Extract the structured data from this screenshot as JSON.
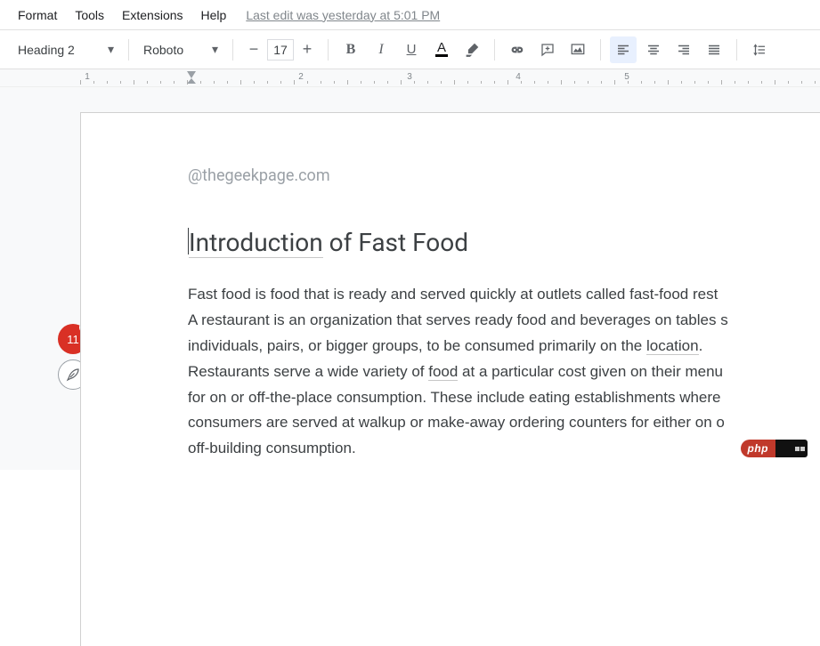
{
  "menubar": {
    "items": [
      "Format",
      "Tools",
      "Extensions",
      "Help"
    ],
    "last_edit": "Last edit was yesterday at 5:01 PM"
  },
  "toolbar": {
    "style_label": "Heading 2",
    "font_label": "Roboto",
    "font_size": "17",
    "minus": "−",
    "plus": "+",
    "bold": "B",
    "italic": "I",
    "underline": "U",
    "text_color": "A"
  },
  "ruler": {
    "numbers": [
      "1",
      "2",
      "3",
      "4",
      "5"
    ]
  },
  "sidebar": {
    "badge_count": "11",
    "badge_plus": "+"
  },
  "document": {
    "watermark": "@thegeekpage.com",
    "heading_word1": "Introduction",
    "heading_rest": " of Fast Food",
    "body_line1a": "Fast food is food that is ready and served quickly at outlets called fast-food rest",
    "body_line2a": "A restaurant is an organization that serves ready food and beverages on tables s",
    "body_line3a": "individuals, pairs, or bigger groups, to be consumed primarily on the ",
    "body_line3_link": "location",
    "body_line3b": ". ",
    "body_line4a": "Restaurants serve a wide variety of ",
    "body_line4_link": "food",
    "body_line4b": " at a particular cost given on their menu",
    "body_line5": "for on or off-the-place consumption. These include eating establishments where",
    "body_line6": "consumers are served at walkup or make-away ordering counters for either on o",
    "body_line7": "off-building consumption."
  },
  "footer": {
    "php": "php"
  }
}
